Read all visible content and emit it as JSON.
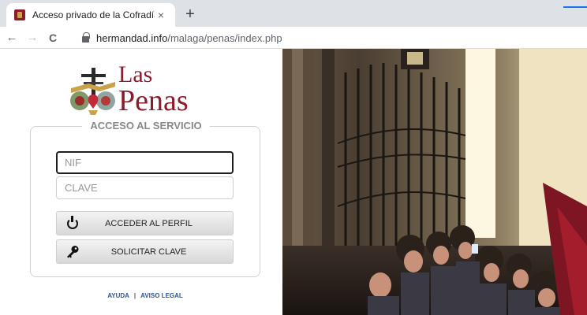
{
  "browser": {
    "tab_title": "Acceso privado de la Cofradía",
    "tab_close": "×",
    "new_tab": "+",
    "back": "←",
    "forward": "→",
    "reload": "C",
    "url_host": "hermandad.info",
    "url_path": "/malaga/penas/index.php"
  },
  "brand": {
    "line1": "Las",
    "line2": "Penas",
    "color": "#8e1b2a"
  },
  "login": {
    "legend": "ACCESO AL SERVICIO",
    "nif_placeholder": "NIF",
    "clave_placeholder": "CLAVE",
    "access_button": "ACCEDER AL PERFIL",
    "request_button": "SOLICITAR CLAVE"
  },
  "footer": {
    "help": "AYUDA",
    "separator": "|",
    "legal": "AVISO LEGAL",
    "link_color": "#2b5797"
  },
  "icons": {
    "power": "power-icon",
    "key": "key-icon",
    "lock": "lock-icon",
    "crest": "crest-icon"
  }
}
